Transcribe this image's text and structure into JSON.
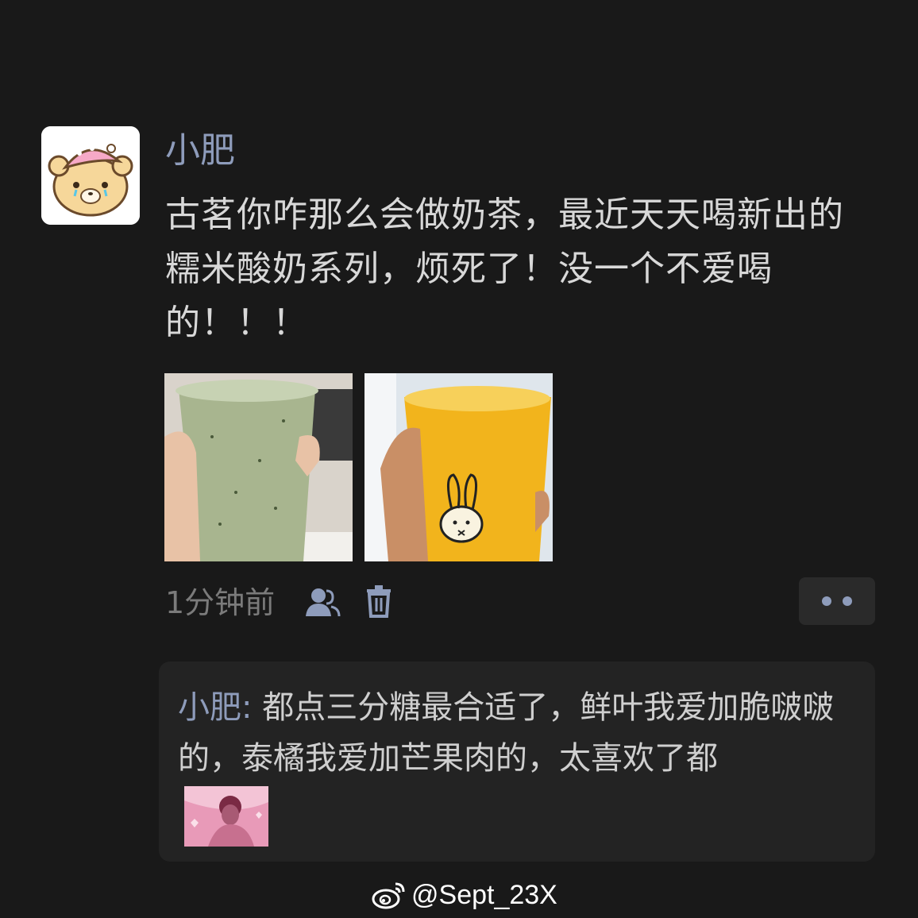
{
  "post": {
    "username": "小肥",
    "text": "古茗你咋那么会做奶茶，最近天天喝新出的糯米酸奶系列，烦死了！没一个不爱喝的！！！",
    "photos": [
      {
        "icon": "matcha-drink-photo"
      },
      {
        "icon": "mango-drink-photo"
      }
    ],
    "timestamp": "1分钟前",
    "icons": {
      "visibility": "friends-icon",
      "delete": "trash-icon",
      "more": "more-dots-icon"
    }
  },
  "comment": {
    "author": "小肥",
    "separator": ": ",
    "text": "都点三分糖最合适了，鲜叶我爱加脆啵啵的，泰橘我爱加芒果肉的，太喜欢了都",
    "sticker": "sticker-image"
  },
  "watermark": {
    "icon": "weibo-icon",
    "handle": "@Sept_23X"
  },
  "colors": {
    "background": "#191919",
    "name_accent": "#8e9cbb",
    "comment_bg": "#232323"
  }
}
